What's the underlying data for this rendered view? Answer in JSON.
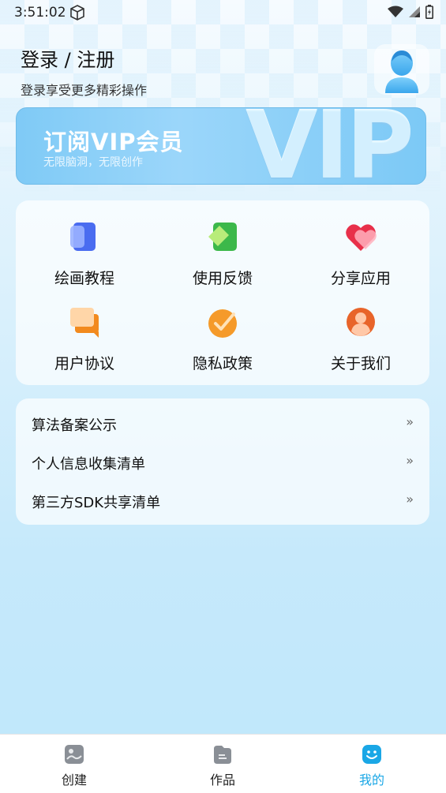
{
  "status_bar": {
    "time": "3:51:02"
  },
  "header": {
    "title": "登录 / 注册",
    "subtitle": "登录享受更多精彩操作"
  },
  "vip_banner": {
    "title": "订阅VIP会员",
    "subtitle": "无限脑洞，无限创作",
    "decor_text": "VIP"
  },
  "grid": {
    "items": [
      {
        "label": "绘画教程",
        "icon": "book-icon"
      },
      {
        "label": "使用反馈",
        "icon": "feedback-icon"
      },
      {
        "label": "分享应用",
        "icon": "heart-icon"
      },
      {
        "label": "用户协议",
        "icon": "chat-icon"
      },
      {
        "label": "隐私政策",
        "icon": "check-badge-icon"
      },
      {
        "label": "关于我们",
        "icon": "user-icon"
      }
    ]
  },
  "list": {
    "items": [
      {
        "label": "算法备案公示",
        "arrow": "»"
      },
      {
        "label": "个人信息收集清单",
        "arrow": "»"
      },
      {
        "label": "第三方SDK共享清单",
        "arrow": "»"
      }
    ]
  },
  "bottom_nav": {
    "items": [
      {
        "label": "创建",
        "active": false
      },
      {
        "label": "作品",
        "active": false
      },
      {
        "label": "我的",
        "active": true
      }
    ]
  },
  "colors": {
    "accent": "#1aa7e6",
    "vip_banner": "#8fd0f8",
    "background": "#dcf1fc"
  }
}
